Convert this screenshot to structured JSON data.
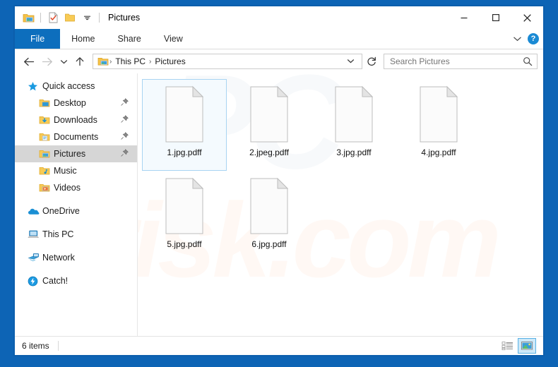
{
  "window": {
    "title": "Pictures",
    "quick_access_toolbar": [
      {
        "name": "explorer-icon",
        "label": "Pictures properties"
      },
      {
        "name": "properties-icon",
        "label": "Properties"
      },
      {
        "name": "new-folder-icon",
        "label": "New folder"
      },
      {
        "name": "chevron-down-icon",
        "label": "Customize Quick Access Toolbar"
      }
    ],
    "controls": {
      "minimize": "–",
      "maximize": "□",
      "close": "✕"
    }
  },
  "ribbon": {
    "tabs": [
      {
        "label": "File",
        "active": true
      },
      {
        "label": "Home",
        "active": false
      },
      {
        "label": "Share",
        "active": false
      },
      {
        "label": "View",
        "active": false
      }
    ],
    "expand_label": "∨",
    "help_label": "?"
  },
  "addressbar": {
    "back": "←",
    "forward": "→",
    "recent": "∨",
    "up": "↑",
    "breadcrumbs": [
      "This PC",
      "Pictures"
    ],
    "separator": "›",
    "dropdown": "∨",
    "refresh": "↻"
  },
  "search": {
    "placeholder": "Search Pictures",
    "value": "",
    "icon": "search-icon"
  },
  "sidebar": {
    "groups": [
      {
        "items": [
          {
            "label": "Quick access",
            "icon": "star-icon",
            "level": 0,
            "pinned": false,
            "selected": false
          },
          {
            "label": "Desktop",
            "icon": "desktop-folder-icon",
            "level": 1,
            "pinned": true,
            "selected": false
          },
          {
            "label": "Downloads",
            "icon": "downloads-folder-icon",
            "level": 1,
            "pinned": true,
            "selected": false
          },
          {
            "label": "Documents",
            "icon": "documents-folder-icon",
            "level": 1,
            "pinned": true,
            "selected": false
          },
          {
            "label": "Pictures",
            "icon": "pictures-folder-icon",
            "level": 1,
            "pinned": true,
            "selected": true
          },
          {
            "label": "Music",
            "icon": "music-folder-icon",
            "level": 1,
            "pinned": false,
            "selected": false
          },
          {
            "label": "Videos",
            "icon": "videos-folder-icon",
            "level": 1,
            "pinned": false,
            "selected": false
          }
        ]
      },
      {
        "items": [
          {
            "label": "OneDrive",
            "icon": "onedrive-cloud-icon",
            "level": 0,
            "pinned": false,
            "selected": false
          }
        ]
      },
      {
        "items": [
          {
            "label": "This PC",
            "icon": "this-pc-icon",
            "level": 0,
            "pinned": false,
            "selected": false
          }
        ]
      },
      {
        "items": [
          {
            "label": "Network",
            "icon": "network-icon",
            "level": 0,
            "pinned": false,
            "selected": false
          }
        ]
      },
      {
        "items": [
          {
            "label": "Catch!",
            "icon": "catch-app-icon",
            "level": 0,
            "pinned": false,
            "selected": false
          }
        ]
      }
    ]
  },
  "files": [
    {
      "name": "1.jpg.pdff",
      "selected": true
    },
    {
      "name": "2.jpeg.pdff",
      "selected": false
    },
    {
      "name": "3.jpg.pdff",
      "selected": false
    },
    {
      "name": "4.jpg.pdff",
      "selected": false
    },
    {
      "name": "5.jpg.pdff",
      "selected": false
    },
    {
      "name": "6.jpg.pdff",
      "selected": false
    }
  ],
  "watermarks": {
    "primary": "risk.com",
    "secondary": "PC"
  },
  "statusbar": {
    "item_count": "6 items",
    "views": [
      {
        "name": "details-view-button",
        "active": false
      },
      {
        "name": "large-icons-view-button",
        "active": true
      }
    ]
  },
  "colors": {
    "accent": "#0d6ebd",
    "desktop": "#0d64b5",
    "selection_border": "#a8d4f2",
    "selection_fill": "#f4fafe",
    "help_blue": "#1a8ad4"
  }
}
